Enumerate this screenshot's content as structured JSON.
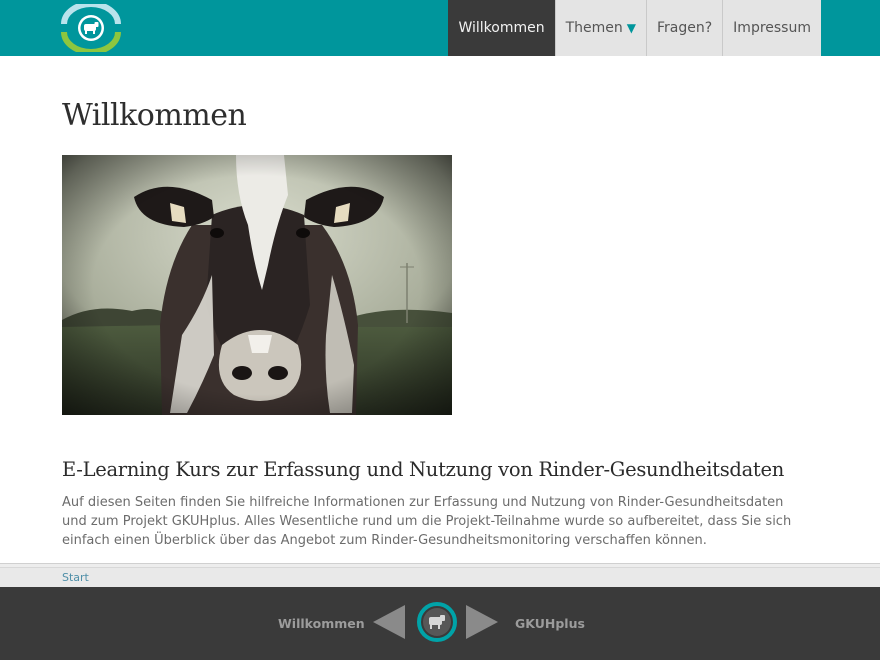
{
  "header": {
    "logo_icon": "cow-target-logo-icon",
    "nav": [
      {
        "label": "Willkommen",
        "active": true
      },
      {
        "label": "Themen",
        "has_dropdown": true,
        "dropdown_icon": "caret-down-icon"
      },
      {
        "label": "Fragen?"
      },
      {
        "label": "Impressum"
      }
    ]
  },
  "main": {
    "title": "Willkommen",
    "hero_image": "cow-portrait-photo",
    "section_title": "E-Learning Kurs zur Erfassung und Nutzung von Rinder-Gesundheitsdaten",
    "intro_text": "Auf diesen Seiten finden Sie hilfreiche Informationen zur Erfassung und Nutzung von Rinder-Gesundheitsdaten und zum Projekt GKUHplus. Alles Wesentliche rund um die Projekt-Teilnahme wurde so aufbereitet, dass Sie sich einfach einen Überblick über das Angebot zum Rinder-Gesundheitsmonitoring verschaffen können."
  },
  "breadcrumb": {
    "label": "Start"
  },
  "pager": {
    "prev_label": "Willkommen",
    "next_label": "GKUHplus",
    "prev_icon": "arrow-left-icon",
    "next_icon": "arrow-right-icon",
    "home_icon": "cow-home-icon"
  },
  "colors": {
    "brand_teal": "#00969c",
    "logo_green": "#8dc63f",
    "dark_bar": "#3a3a3a",
    "nav_inactive": "#e4e4e4"
  }
}
